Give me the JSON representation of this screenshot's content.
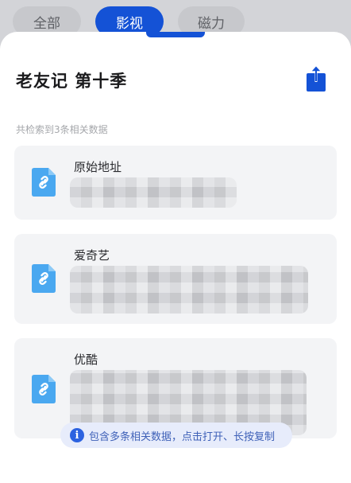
{
  "tabs": [
    {
      "label": "全部",
      "active": false
    },
    {
      "label": "影视",
      "active": true
    },
    {
      "label": "磁力",
      "active": false
    }
  ],
  "sheet": {
    "title": "老友记 第十季",
    "share_icon": "share-upload-icon",
    "summary": "共检索到3条相关数据"
  },
  "results": [
    {
      "source": "原始地址",
      "icon": "link-file-icon"
    },
    {
      "source": "爱奇艺",
      "icon": "link-file-icon"
    },
    {
      "source": "优酷",
      "icon": "link-file-icon"
    }
  ],
  "hint": {
    "icon": "info-icon",
    "text": "包含多条相关数据，点击打开、长按复制"
  },
  "colors": {
    "accent": "#1452d6",
    "card_bg": "#f3f4f6",
    "file_icon": "#4aa8f0"
  }
}
